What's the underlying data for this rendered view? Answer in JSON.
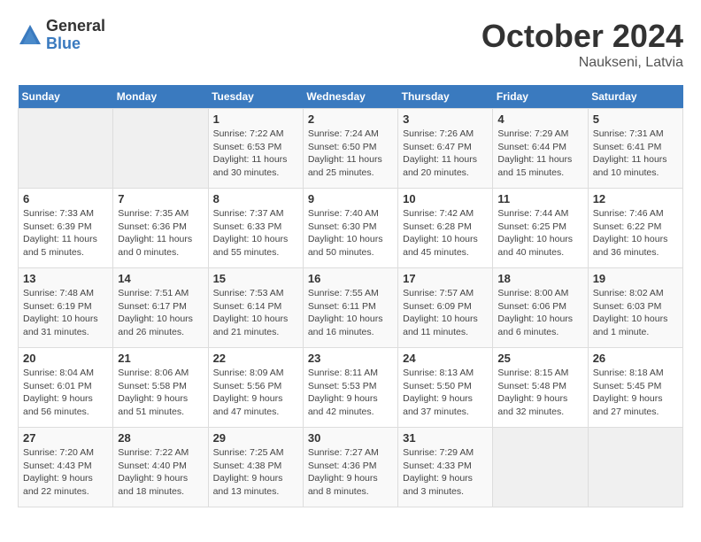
{
  "logo": {
    "general": "General",
    "blue": "Blue"
  },
  "header": {
    "month": "October 2024",
    "location": "Naukseni, Latvia"
  },
  "weekdays": [
    "Sunday",
    "Monday",
    "Tuesday",
    "Wednesday",
    "Thursday",
    "Friday",
    "Saturday"
  ],
  "weeks": [
    [
      {
        "day": null
      },
      {
        "day": null
      },
      {
        "day": "1",
        "sunrise": "Sunrise: 7:22 AM",
        "sunset": "Sunset: 6:53 PM",
        "daylight": "Daylight: 11 hours and 30 minutes."
      },
      {
        "day": "2",
        "sunrise": "Sunrise: 7:24 AM",
        "sunset": "Sunset: 6:50 PM",
        "daylight": "Daylight: 11 hours and 25 minutes."
      },
      {
        "day": "3",
        "sunrise": "Sunrise: 7:26 AM",
        "sunset": "Sunset: 6:47 PM",
        "daylight": "Daylight: 11 hours and 20 minutes."
      },
      {
        "day": "4",
        "sunrise": "Sunrise: 7:29 AM",
        "sunset": "Sunset: 6:44 PM",
        "daylight": "Daylight: 11 hours and 15 minutes."
      },
      {
        "day": "5",
        "sunrise": "Sunrise: 7:31 AM",
        "sunset": "Sunset: 6:41 PM",
        "daylight": "Daylight: 11 hours and 10 minutes."
      }
    ],
    [
      {
        "day": "6",
        "sunrise": "Sunrise: 7:33 AM",
        "sunset": "Sunset: 6:39 PM",
        "daylight": "Daylight: 11 hours and 5 minutes."
      },
      {
        "day": "7",
        "sunrise": "Sunrise: 7:35 AM",
        "sunset": "Sunset: 6:36 PM",
        "daylight": "Daylight: 11 hours and 0 minutes."
      },
      {
        "day": "8",
        "sunrise": "Sunrise: 7:37 AM",
        "sunset": "Sunset: 6:33 PM",
        "daylight": "Daylight: 10 hours and 55 minutes."
      },
      {
        "day": "9",
        "sunrise": "Sunrise: 7:40 AM",
        "sunset": "Sunset: 6:30 PM",
        "daylight": "Daylight: 10 hours and 50 minutes."
      },
      {
        "day": "10",
        "sunrise": "Sunrise: 7:42 AM",
        "sunset": "Sunset: 6:28 PM",
        "daylight": "Daylight: 10 hours and 45 minutes."
      },
      {
        "day": "11",
        "sunrise": "Sunrise: 7:44 AM",
        "sunset": "Sunset: 6:25 PM",
        "daylight": "Daylight: 10 hours and 40 minutes."
      },
      {
        "day": "12",
        "sunrise": "Sunrise: 7:46 AM",
        "sunset": "Sunset: 6:22 PM",
        "daylight": "Daylight: 10 hours and 36 minutes."
      }
    ],
    [
      {
        "day": "13",
        "sunrise": "Sunrise: 7:48 AM",
        "sunset": "Sunset: 6:19 PM",
        "daylight": "Daylight: 10 hours and 31 minutes."
      },
      {
        "day": "14",
        "sunrise": "Sunrise: 7:51 AM",
        "sunset": "Sunset: 6:17 PM",
        "daylight": "Daylight: 10 hours and 26 minutes."
      },
      {
        "day": "15",
        "sunrise": "Sunrise: 7:53 AM",
        "sunset": "Sunset: 6:14 PM",
        "daylight": "Daylight: 10 hours and 21 minutes."
      },
      {
        "day": "16",
        "sunrise": "Sunrise: 7:55 AM",
        "sunset": "Sunset: 6:11 PM",
        "daylight": "Daylight: 10 hours and 16 minutes."
      },
      {
        "day": "17",
        "sunrise": "Sunrise: 7:57 AM",
        "sunset": "Sunset: 6:09 PM",
        "daylight": "Daylight: 10 hours and 11 minutes."
      },
      {
        "day": "18",
        "sunrise": "Sunrise: 8:00 AM",
        "sunset": "Sunset: 6:06 PM",
        "daylight": "Daylight: 10 hours and 6 minutes."
      },
      {
        "day": "19",
        "sunrise": "Sunrise: 8:02 AM",
        "sunset": "Sunset: 6:03 PM",
        "daylight": "Daylight: 10 hours and 1 minute."
      }
    ],
    [
      {
        "day": "20",
        "sunrise": "Sunrise: 8:04 AM",
        "sunset": "Sunset: 6:01 PM",
        "daylight": "Daylight: 9 hours and 56 minutes."
      },
      {
        "day": "21",
        "sunrise": "Sunrise: 8:06 AM",
        "sunset": "Sunset: 5:58 PM",
        "daylight": "Daylight: 9 hours and 51 minutes."
      },
      {
        "day": "22",
        "sunrise": "Sunrise: 8:09 AM",
        "sunset": "Sunset: 5:56 PM",
        "daylight": "Daylight: 9 hours and 47 minutes."
      },
      {
        "day": "23",
        "sunrise": "Sunrise: 8:11 AM",
        "sunset": "Sunset: 5:53 PM",
        "daylight": "Daylight: 9 hours and 42 minutes."
      },
      {
        "day": "24",
        "sunrise": "Sunrise: 8:13 AM",
        "sunset": "Sunset: 5:50 PM",
        "daylight": "Daylight: 9 hours and 37 minutes."
      },
      {
        "day": "25",
        "sunrise": "Sunrise: 8:15 AM",
        "sunset": "Sunset: 5:48 PM",
        "daylight": "Daylight: 9 hours and 32 minutes."
      },
      {
        "day": "26",
        "sunrise": "Sunrise: 8:18 AM",
        "sunset": "Sunset: 5:45 PM",
        "daylight": "Daylight: 9 hours and 27 minutes."
      }
    ],
    [
      {
        "day": "27",
        "sunrise": "Sunrise: 7:20 AM",
        "sunset": "Sunset: 4:43 PM",
        "daylight": "Daylight: 9 hours and 22 minutes."
      },
      {
        "day": "28",
        "sunrise": "Sunrise: 7:22 AM",
        "sunset": "Sunset: 4:40 PM",
        "daylight": "Daylight: 9 hours and 18 minutes."
      },
      {
        "day": "29",
        "sunrise": "Sunrise: 7:25 AM",
        "sunset": "Sunset: 4:38 PM",
        "daylight": "Daylight: 9 hours and 13 minutes."
      },
      {
        "day": "30",
        "sunrise": "Sunrise: 7:27 AM",
        "sunset": "Sunset: 4:36 PM",
        "daylight": "Daylight: 9 hours and 8 minutes."
      },
      {
        "day": "31",
        "sunrise": "Sunrise: 7:29 AM",
        "sunset": "Sunset: 4:33 PM",
        "daylight": "Daylight: 9 hours and 3 minutes."
      },
      {
        "day": null
      },
      {
        "day": null
      }
    ]
  ]
}
